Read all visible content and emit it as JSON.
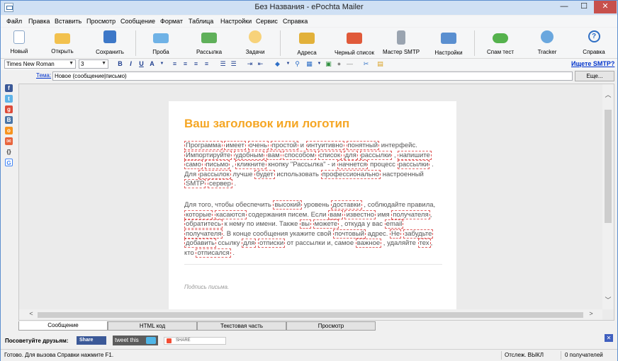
{
  "window": {
    "title": "Без Названия - ePochta Mailer",
    "minimize_glyph": "—",
    "maximize_glyph": "☐",
    "close_glyph": "✕"
  },
  "menu": [
    "Файл",
    "Правка",
    "Вставить",
    "Просмотр",
    "Сообщение",
    "Формат",
    "Таблица",
    "Настройки",
    "Сервис",
    "Справка"
  ],
  "toolbar": [
    {
      "label": "Новый",
      "icon": "new-document-icon"
    },
    {
      "label": "Открыть",
      "icon": "folder-open-icon"
    },
    {
      "label": "Сохранить",
      "icon": "save-disk-icon"
    },
    {
      "label": "Проба",
      "icon": "test-send-icon"
    },
    {
      "label": "Рассылка",
      "icon": "mailing-icon"
    },
    {
      "label": "Задачи",
      "icon": "tasks-clock-icon"
    },
    {
      "label": "Адреса",
      "icon": "address-book-icon"
    },
    {
      "label": "Черный список",
      "icon": "blacklist-warning-icon"
    },
    {
      "label": "Мастер SMTP",
      "icon": "smtp-server-icon"
    },
    {
      "label": "Настройки",
      "icon": "settings-icon"
    },
    {
      "label": "Спам тест",
      "icon": "spam-test-icon"
    },
    {
      "label": "Tracker",
      "icon": "tracker-globe-icon"
    },
    {
      "label": "Справка",
      "icon": "help-icon"
    }
  ],
  "format": {
    "font_name": "Times New Roman",
    "font_size": "3",
    "need_smtp": "Ищете SMTP?"
  },
  "subject": {
    "label": "Тема:",
    "value": "Новое (сообщение|письмо)",
    "more_button": "Еще..."
  },
  "message": {
    "heading": "Ваш заголовок или логотип",
    "p1": [
      {
        "t": "Программа",
        "s": 1
      },
      {
        "t": " ",
        "s": 0
      },
      {
        "t": "имеет",
        "s": 1
      },
      {
        "t": " ",
        "s": 0
      },
      {
        "t": "очень",
        "s": 1
      },
      {
        "t": " ",
        "s": 0
      },
      {
        "t": "простой",
        "s": 1
      },
      {
        "t": " и ",
        "s": 0
      },
      {
        "t": "интуитивно",
        "s": 1
      },
      {
        "t": " ",
        "s": 0
      },
      {
        "t": "понятный",
        "s": 1
      },
      {
        "t": " интерфейс. ",
        "s": 0
      },
      {
        "t": "Импортируйте",
        "s": 1
      },
      {
        "t": " ",
        "s": 0
      },
      {
        "t": "удобным",
        "s": 1
      },
      {
        "t": " ",
        "s": 0
      },
      {
        "t": "вам",
        "s": 1
      },
      {
        "t": " ",
        "s": 0
      },
      {
        "t": "способом",
        "s": 1
      },
      {
        "t": " ",
        "s": 0
      },
      {
        "t": "список",
        "s": 1
      },
      {
        "t": " ",
        "s": 0
      },
      {
        "t": "для",
        "s": 1
      },
      {
        "t": " ",
        "s": 0
      },
      {
        "t": "рассылки",
        "s": 1
      },
      {
        "t": " , ",
        "s": 0
      },
      {
        "t": "напишите",
        "s": 1
      },
      {
        "t": " ",
        "s": 0
      },
      {
        "t": "само",
        "s": 1
      },
      {
        "t": " ",
        "s": 0
      },
      {
        "t": "письмо",
        "s": 1
      },
      {
        "t": " , ",
        "s": 0
      },
      {
        "t": "кликните",
        "s": 1
      },
      {
        "t": " кнопку \"Рассылка\" - и ",
        "s": 0
      },
      {
        "t": "начнется",
        "s": 1
      },
      {
        "t": " процесс ",
        "s": 0
      },
      {
        "t": "рассылки",
        "s": 1
      },
      {
        "t": " . Для ",
        "s": 0
      },
      {
        "t": "рассылок",
        "s": 1
      },
      {
        "t": " лучше ",
        "s": 0
      },
      {
        "t": "будет",
        "s": 1
      },
      {
        "t": " использовать ",
        "s": 0
      },
      {
        "t": "профессионально",
        "s": 1
      },
      {
        "t": " настроенный ",
        "s": 0
      },
      {
        "t": "SMTP",
        "s": 1
      },
      {
        "t": " ",
        "s": 0
      },
      {
        "t": "сервер",
        "s": 1
      },
      {
        "t": " .",
        "s": 0
      }
    ],
    "p2": [
      {
        "t": "Для того, чтобы обеспечить ",
        "s": 0
      },
      {
        "t": "высокий",
        "s": 1
      },
      {
        "t": " уровень ",
        "s": 0
      },
      {
        "t": "доставки",
        "s": 1
      },
      {
        "t": " , соблюдайте ",
        "s": 0
      },
      {
        "t": "правила,",
        "s": 0
      },
      {
        "t": " ",
        "s": 0
      },
      {
        "t": "которые",
        "s": 1
      },
      {
        "t": " ",
        "s": 0
      },
      {
        "t": "касаются",
        "s": 1
      },
      {
        "t": " содержания писем. Если ",
        "s": 0
      },
      {
        "t": "вам",
        "s": 1
      },
      {
        "t": " ",
        "s": 0
      },
      {
        "t": "известно",
        "s": 1
      },
      {
        "t": " имя ",
        "s": 0
      },
      {
        "t": "получателя",
        "s": 1
      },
      {
        "t": ", ",
        "s": 0
      },
      {
        "t": "обратитесь",
        "s": 1
      },
      {
        "t": " к нему по имени. Также ",
        "s": 0
      },
      {
        "t": "вы",
        "s": 1
      },
      {
        "t": " ",
        "s": 0
      },
      {
        "t": "можете",
        "s": 1
      },
      {
        "t": " , откуда у вас ",
        "s": 0
      },
      {
        "t": "email",
        "s": 1
      },
      {
        "t": " ",
        "s": 0
      },
      {
        "t": "получателя",
        "s": 1
      },
      {
        "t": ". В конце сообщения укажите свой ",
        "s": 0
      },
      {
        "t": "почтовый",
        "s": 1
      },
      {
        "t": " адрес. ",
        "s": 0
      },
      {
        "t": "Не",
        "s": 1
      },
      {
        "t": " ",
        "s": 0
      },
      {
        "t": "забудьте",
        "s": 1
      },
      {
        "t": " ",
        "s": 0
      },
      {
        "t": "добавить",
        "s": 1
      },
      {
        "t": " ссылку ",
        "s": 0
      },
      {
        "t": "для",
        "s": 1
      },
      {
        "t": " ",
        "s": 0
      },
      {
        "t": "отписки",
        "s": 1
      },
      {
        "t": " от рассылки и, самое ",
        "s": 0
      },
      {
        "t": "важное",
        "s": 1
      },
      {
        "t": " , ",
        "s": 0
      },
      {
        "t": "удаляйте",
        "s": 0
      },
      {
        "t": " ",
        "s": 0
      },
      {
        "t": "тех",
        "s": 1
      },
      {
        "t": ", кто ",
        "s": 0
      },
      {
        "t": "отписался",
        "s": 1
      },
      {
        "t": " .",
        "s": 0
      }
    ],
    "signature": "Подпись письма."
  },
  "tabs": [
    {
      "label": "Сообщение",
      "active": true
    },
    {
      "label": "HTML код",
      "active": false
    },
    {
      "label": "Текстовая часть",
      "active": false
    },
    {
      "label": "Просмотр",
      "active": false
    }
  ],
  "share": {
    "label": "Посоветуйте друзьям:",
    "facebook": "Share",
    "twitter": "tweet this",
    "addthis": "SHARE"
  },
  "status": {
    "hint": "Готово. Для вызова Справки нажмите F1.",
    "tracking": "Отслеж. ВЫКЛ",
    "recipients": "0 получателей"
  },
  "colors": {
    "heading": "#f5a623",
    "title_bg": "#cfe0f4",
    "close_bg": "#c7504c",
    "link": "#0033cc"
  }
}
